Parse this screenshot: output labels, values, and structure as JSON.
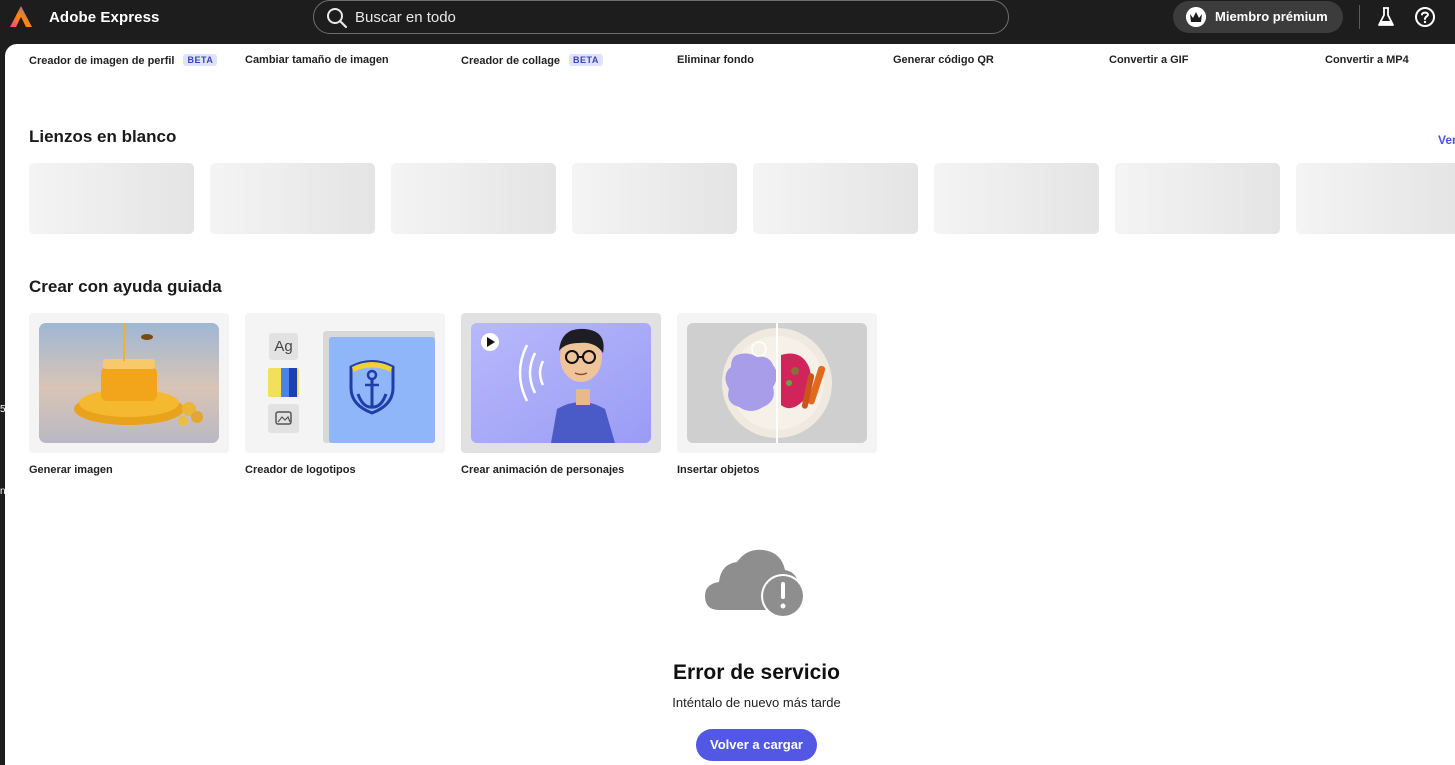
{
  "app": {
    "title": "Adobe Express"
  },
  "search": {
    "placeholder": "Buscar en todo",
    "icon": "search-icon"
  },
  "header": {
    "premium_label": "Miembro prémium"
  },
  "edge_marks": [
    "5",
    "n"
  ],
  "quick_actions": [
    {
      "label": "Creador de imagen de perfil",
      "badge": "BETA"
    },
    {
      "label": "Cambiar tamaño de imagen"
    },
    {
      "label": "Creador de collage",
      "badge": "BETA"
    },
    {
      "label": "Eliminar fondo"
    },
    {
      "label": "Generar código QR"
    },
    {
      "label": "Convertir a GIF"
    },
    {
      "label": "Convertir a MP4"
    }
  ],
  "blank_canvases": {
    "title": "Lienzos en blanco",
    "see_all": "Ver"
  },
  "guided": {
    "title": "Crear con ayuda guiada",
    "items": [
      {
        "label": "Generar imagen"
      },
      {
        "label": "Creador de logotipos",
        "tile_text": "Ag"
      },
      {
        "label": "Crear animación de personajes"
      },
      {
        "label": "Insertar objetos"
      }
    ]
  },
  "error": {
    "title": "Error de servicio",
    "message": "Inténtalo de nuevo más tarde",
    "button": "Volver a cargar"
  },
  "colors": {
    "topbar": "#1d1d1d",
    "accent": "#5258e4",
    "beta_bg": "#dfe2fb",
    "beta_text": "#3a45b8",
    "see_all": "#4b55d4"
  }
}
